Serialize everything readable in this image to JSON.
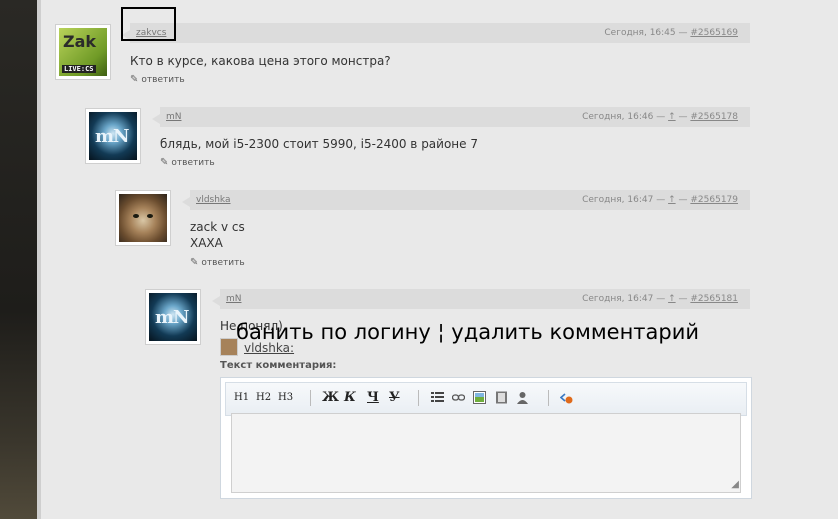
{
  "comments": [
    {
      "author": "zakvcs",
      "time": "Сегодня, 16:45 —",
      "id": "#2565169",
      "parent": "",
      "text": "Кто в курсе, какова цена этого монстра?",
      "reply": "ответить",
      "avatar_text": "Zak",
      "avatar_tag": "LIVE:CS"
    },
    {
      "author": "mN",
      "time": "Сегодня, 16:46 —",
      "parent": "↑",
      "sep": "—",
      "id": "#2565178",
      "text": "блядь, мой i5-2300 стоит 5990, i5-2400 в районе 7",
      "reply": "ответить",
      "avatar_text": "mN"
    },
    {
      "author": "vldshka",
      "time": "Сегодня, 16:47 —",
      "parent": "↑",
      "sep": "—",
      "id": "#2565179",
      "text1": "zack v cs",
      "text2": "ХАХА",
      "reply": "ответить"
    },
    {
      "author": "mN",
      "time": "Сегодня, 16:47 —",
      "parent": "↑",
      "sep": "—",
      "id": "#2565181",
      "text": "Не понял)",
      "avatar_text": "mN"
    }
  ],
  "overlay": "банить по логину ¦ удалить комментарий",
  "answer_to": "vldshka",
  "colon": ":",
  "editor": {
    "label": "Текст комментария:",
    "buttons": {
      "h1": "H1",
      "h2": "H2",
      "h3": "H3",
      "bold": "Ж",
      "italic": "К",
      "underline": "Ч",
      "strike": "У"
    }
  }
}
